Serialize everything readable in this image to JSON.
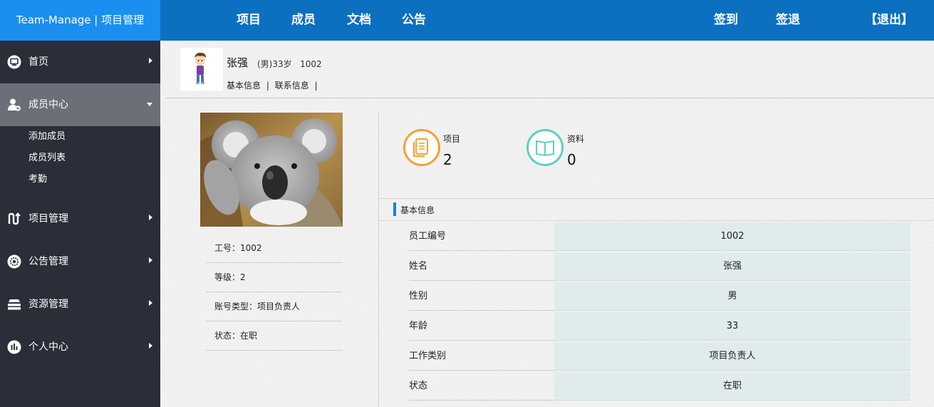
{
  "header": {
    "brand": "Team-Manage | 项目管理",
    "nav": [
      "项目",
      "成员",
      "文档",
      "公告"
    ],
    "sign_in": "签到",
    "sign_out": "签退",
    "logout": "【退出】"
  },
  "sidebar": {
    "items": [
      {
        "label": "首页",
        "icon": "monitor-icon"
      },
      {
        "label": "成员中心",
        "icon": "user-gear-icon",
        "active": true
      },
      {
        "label": "项目管理",
        "icon": "project-icon"
      },
      {
        "label": "公告管理",
        "icon": "gear-icon"
      },
      {
        "label": "资源管理",
        "icon": "layers-icon"
      },
      {
        "label": "个人中心",
        "icon": "bar-chart-icon"
      }
    ],
    "submenu": [
      "添加成员",
      "成员列表",
      "考勤"
    ]
  },
  "profile": {
    "name": "张强",
    "meta": "(男)33岁   1002",
    "links": [
      "基本信息",
      "联系信息"
    ],
    "sep": "|"
  },
  "left_info": [
    "工号：1002",
    "等级：2",
    "账号类型：项目负责人",
    "状态：在职"
  ],
  "stats": [
    {
      "label": "项目",
      "value": "2",
      "color": "#f5a030"
    },
    {
      "label": "资料",
      "value": "0",
      "color": "#5ecfc0"
    }
  ],
  "basic_info": {
    "title": "基本信息",
    "rows": [
      {
        "key": "员工编号",
        "value": "1002"
      },
      {
        "key": "姓名",
        "value": "张强"
      },
      {
        "key": "性别",
        "value": "男"
      },
      {
        "key": "年龄",
        "value": "33"
      },
      {
        "key": "工作类别",
        "value": "项目负责人"
      },
      {
        "key": "状态",
        "value": "在职"
      }
    ]
  },
  "colors": {
    "topbar": "#0b70c0",
    "brand_bg": "#1a8ff0",
    "sidebar": "#2b2e38",
    "sidebar_active": "#6b6f78",
    "cell_bg": "#e0eceb",
    "accent": "#1a80e0"
  }
}
